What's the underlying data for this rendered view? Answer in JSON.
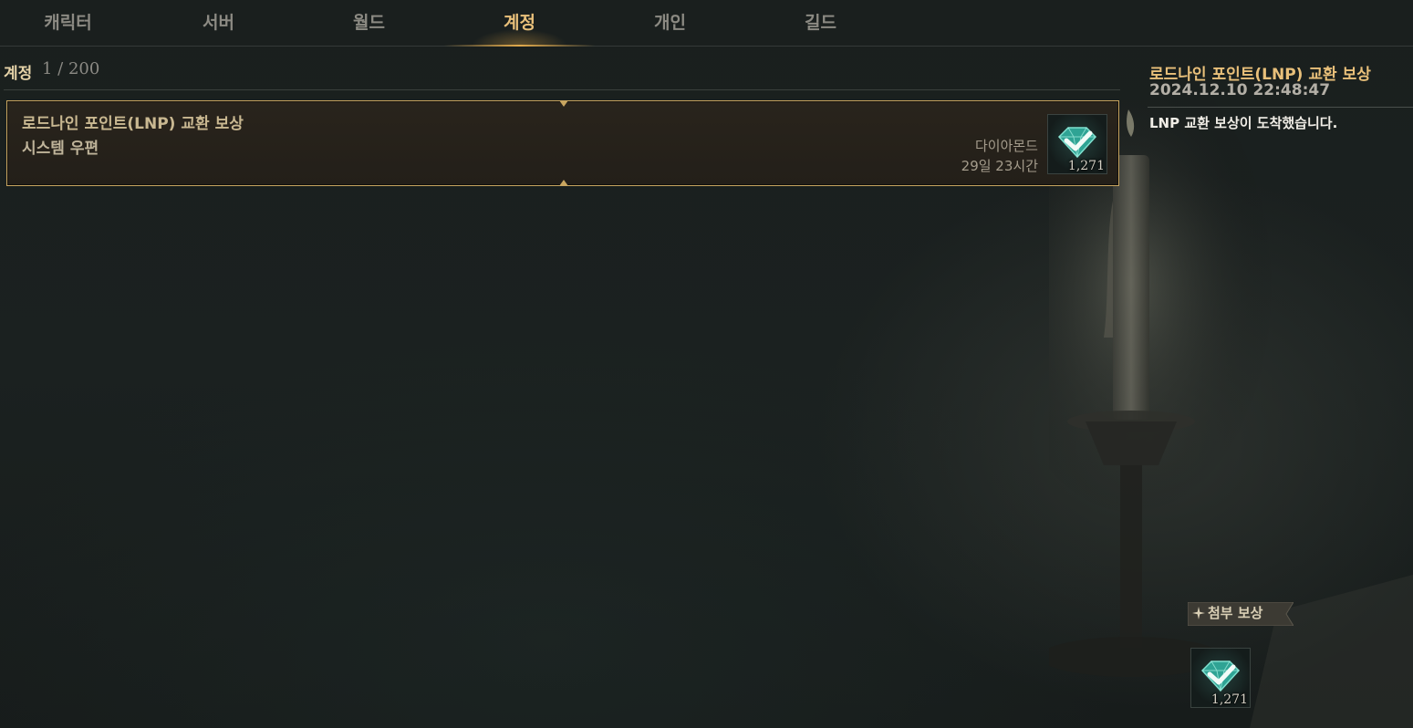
{
  "tabs": [
    {
      "label": "캐릭터",
      "active": false
    },
    {
      "label": "서버",
      "active": false
    },
    {
      "label": "월드",
      "active": false
    },
    {
      "label": "계정",
      "active": true
    },
    {
      "label": "개인",
      "active": false
    },
    {
      "label": "길드",
      "active": false
    }
  ],
  "mailbox": {
    "category_label": "계정",
    "count": "1 / 200"
  },
  "mails": [
    {
      "title": "로드나인 포인트(LNP) 교환 보상",
      "sender": "시스템 우편",
      "reward_name": "다이아몬드",
      "expires": "29일 23시간",
      "item_icon": "diamond-icon",
      "item_qty": "1,271"
    }
  ],
  "detail": {
    "title": "로드나인 포인트(LNP) 교환 보상",
    "date": "2024.12.10 22:48:47",
    "body": "LNP 교환 보상이 도착했습니다.",
    "attachments_label": "첨부 보상",
    "attachment_icon": "diamond-icon",
    "attachment_qty": "1,271"
  },
  "colors": {
    "accent": "#e9c07a",
    "selected_border": "#c9a660",
    "background": "#1b1f1e"
  }
}
